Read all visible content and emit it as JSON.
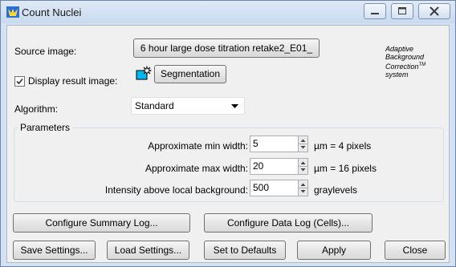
{
  "window": {
    "title": "Count Nuclei"
  },
  "source": {
    "label": "Source image:",
    "button": "6 hour large dose titration retake2_E01_"
  },
  "display": {
    "label": "Display result image:",
    "checked": true,
    "segmentation_label": "Segmentation"
  },
  "abc_note": {
    "line1": "Adaptive",
    "line2": "Background",
    "line3": "Correction",
    "tm": "TM",
    "line4": "system"
  },
  "algorithm": {
    "label": "Algorithm:",
    "value": "Standard"
  },
  "parameters": {
    "title": "Parameters",
    "rows": [
      {
        "label": "Approximate min width:",
        "value": "5",
        "unit": "µm = 4 pixels"
      },
      {
        "label": "Approximate max width:",
        "value": "20",
        "unit": "µm = 16 pixels"
      },
      {
        "label": "Intensity above local background:",
        "value": "500",
        "unit": "graylevels"
      }
    ]
  },
  "buttons": {
    "summary_log": "Configure Summary Log...",
    "data_log": "Configure Data Log (Cells)...",
    "save": "Save Settings...",
    "load": "Load Settings...",
    "defaults": "Set to Defaults",
    "apply": "Apply",
    "close": "Close"
  }
}
